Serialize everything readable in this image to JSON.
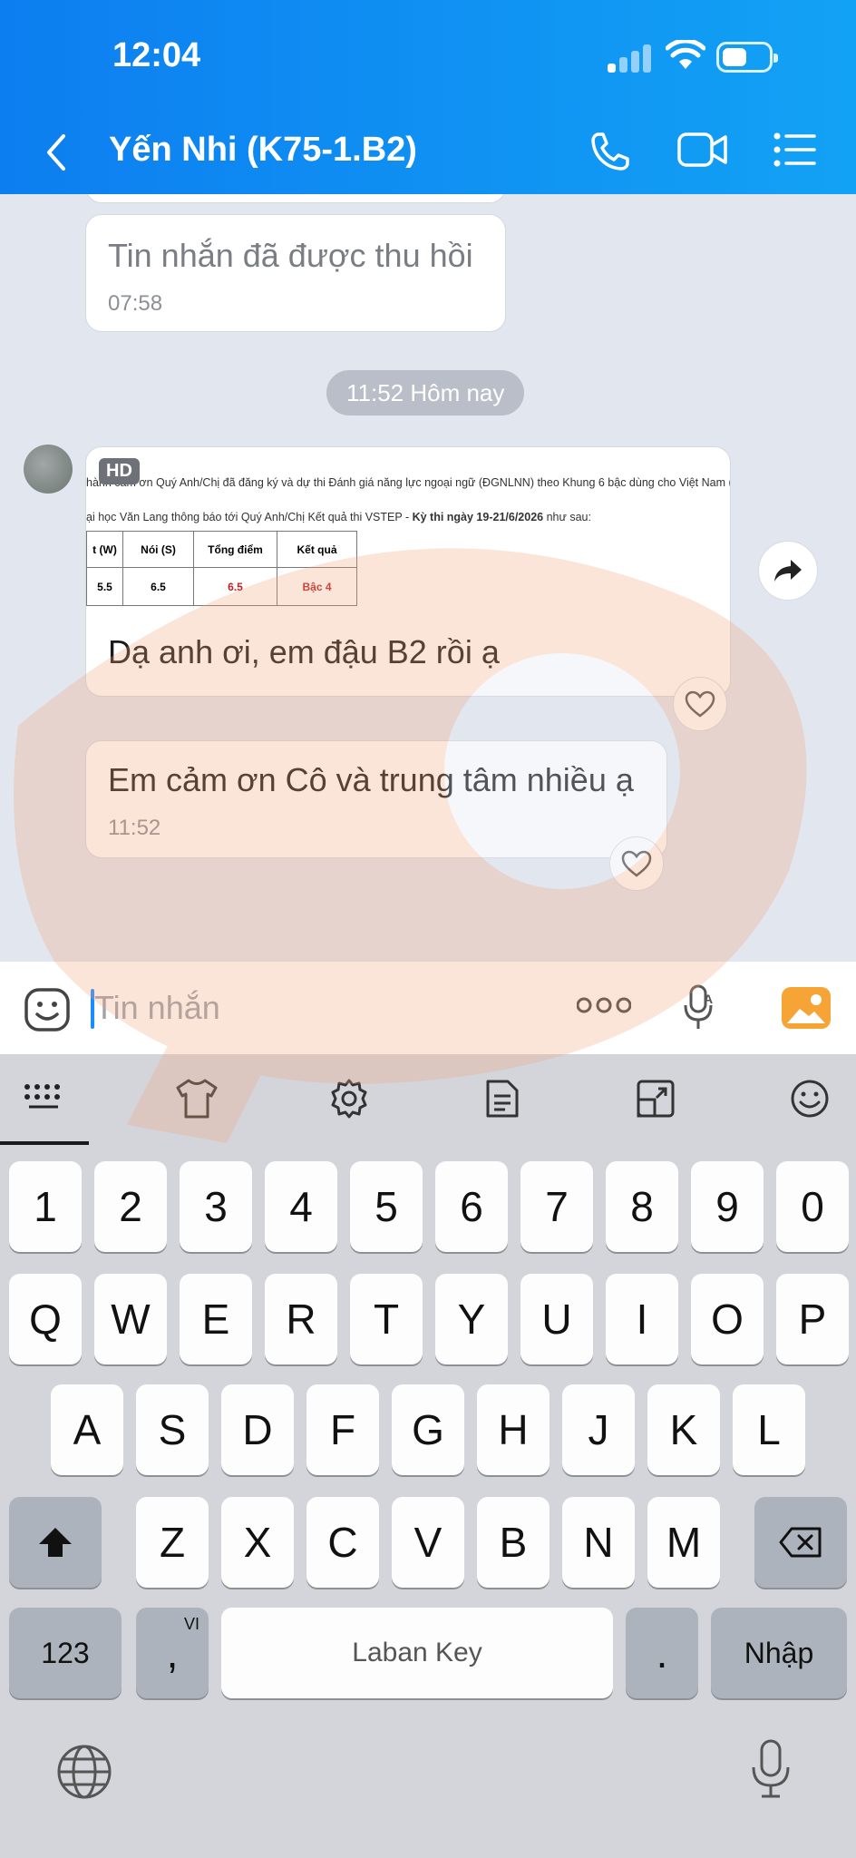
{
  "status_bar": {
    "time": "12:04"
  },
  "header": {
    "title": "Yến Nhi (K75-1.B2)",
    "icons": [
      "back-icon",
      "phone-icon",
      "video-icon",
      "menu-icon"
    ]
  },
  "chat": {
    "recalled": {
      "text": "Tin nhắn đã được thu hồi",
      "time": "07:58"
    },
    "date_divider": "11:52 Hôm nay",
    "image_message": {
      "hd_badge": "HD",
      "doc_line1": "hành cảm ơn Quý Anh/Chị đã đăng ký và dự thi Đánh giá năng lực ngoại ngữ (ĐGNLNN) theo Khung 6 bậc dùng cho Việt Nam (V",
      "doc_line2_prefix": "ại học Văn Lang thông báo tới Quý Anh/Chị Kết quả thi VSTEP - ",
      "doc_line2_bold": "Kỳ thi ngày 19-21/6/2026",
      "doc_line2_suffix": " như sau:",
      "table_headers": [
        "t (W)",
        "Nói (S)",
        "Tổng điểm",
        "Kết quả"
      ],
      "table_values": [
        "5.5",
        "6.5",
        "6.5",
        "Bậc 4"
      ],
      "caption": "Dạ anh ơi, em đậu B2 rồi ạ"
    },
    "message2": {
      "text": "Em cảm ơn Cô và trung tâm nhiều ạ",
      "time": "11:52"
    }
  },
  "input": {
    "placeholder": "Tin nhắn"
  },
  "keyboard": {
    "row_numbers": [
      "1",
      "2",
      "3",
      "4",
      "5",
      "6",
      "7",
      "8",
      "9",
      "0"
    ],
    "row1": [
      "Q",
      "W",
      "E",
      "R",
      "T",
      "Y",
      "U",
      "I",
      "O",
      "P"
    ],
    "row2": [
      "A",
      "S",
      "D",
      "F",
      "G",
      "H",
      "J",
      "K",
      "L"
    ],
    "row3": [
      "Z",
      "X",
      "C",
      "V",
      "B",
      "N",
      "M"
    ],
    "mode_key": "123",
    "comma_key": ",",
    "comma_superscript": "VI",
    "space_label": "Laban Key",
    "period_key": ".",
    "enter_key": "Nhập"
  },
  "colors": {
    "header_start": "#0d7ef0",
    "header_end": "#12a2f5",
    "photo_icon": "#f7a437",
    "watermark": "#f6c7a8"
  }
}
